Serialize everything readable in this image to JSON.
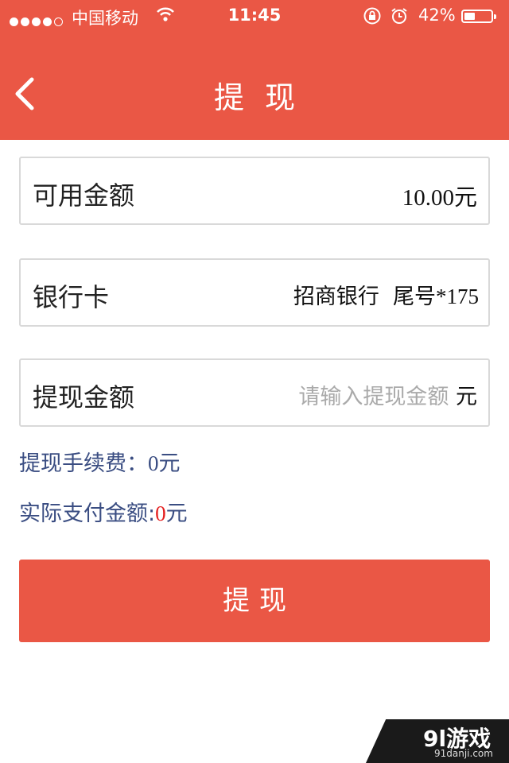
{
  "status_bar": {
    "carrier": "中国移动",
    "time": "11:45",
    "battery": "42%"
  },
  "nav": {
    "title": "提现"
  },
  "available": {
    "label": "可用金额",
    "amount": "10.00",
    "unit": "元"
  },
  "bank_card": {
    "label": "银行卡",
    "bank_name": "招商银行",
    "tail_prefix": "尾号",
    "tail_number": "*175"
  },
  "withdraw_amount": {
    "label": "提现金额",
    "placeholder": "请输入提现金额",
    "unit": "元"
  },
  "fee": {
    "label": "提现手续费：",
    "value": "0",
    "unit": "元"
  },
  "actual": {
    "label": "实际支付金额:",
    "value": "0",
    "unit": "元"
  },
  "submit": {
    "label": "提现"
  },
  "watermark": {
    "brand": "9l游戏",
    "url": "91danji.com"
  },
  "colors": {
    "accent": "#ea5745",
    "info_text": "#3a4d82",
    "highlight": "#e41f1f"
  }
}
